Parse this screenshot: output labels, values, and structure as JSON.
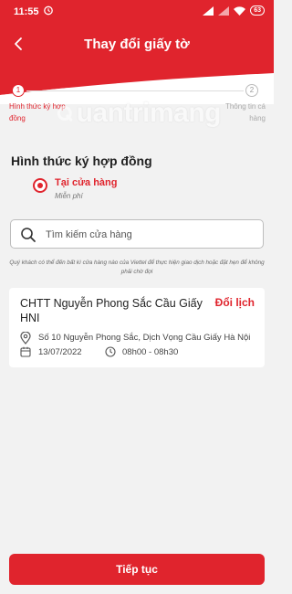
{
  "status_bar": {
    "time": "11:55",
    "battery": "63"
  },
  "header": {
    "title": "Thay đổi giấy tờ"
  },
  "stepper": {
    "steps": [
      {
        "number": "1",
        "label": "Hình thức ký hợp đồng"
      },
      {
        "number": "2",
        "label": "Thông tin cá hàng"
      }
    ]
  },
  "watermark": {
    "text": "uantrimang"
  },
  "contract_method": {
    "title": "Hình thức ký hợp đồng",
    "option_label": "Tại cửa hàng",
    "option_sub": "Miễn phí"
  },
  "search": {
    "placeholder": "Tìm kiếm cửa hàng",
    "value": ""
  },
  "notice": "Quý khách có thể đến bất kì cửa hàng nào của Viettel để thực hiện giao dịch hoặc đặt hẹn để không phải chờ đợi",
  "store": {
    "name": "CHTT Nguyễn Phong Sắc Cầu Giấy HNI",
    "reschedule_label": "Đổi lịch",
    "address": "Số 10 Nguyễn Phong Sắc, Dịch Vọng Cầu Giấy Hà Nội",
    "date": "13/07/2022",
    "time": "08h00 - 08h30"
  },
  "continue_label": "Tiếp tục",
  "colors": {
    "brand": "#e0242d"
  }
}
